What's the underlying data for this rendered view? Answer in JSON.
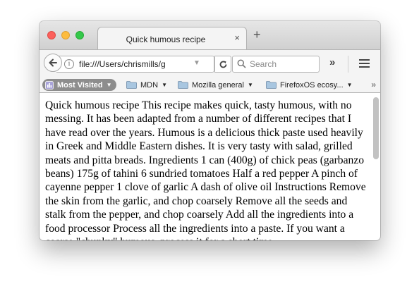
{
  "window": {
    "tab": {
      "title": "Quick humous recipe",
      "close_glyph": "×"
    },
    "new_tab_glyph": "+"
  },
  "navbar": {
    "url": "file:///Users/chrismills/g",
    "search_placeholder": "Search",
    "overflow_glyph": "»"
  },
  "bookmarks": {
    "items": [
      {
        "label": "Most Visited",
        "icon": "most-visited-icon",
        "dropdown": true
      },
      {
        "label": "MDN",
        "icon": "folder-icon",
        "dropdown": true
      },
      {
        "label": "Mozilla general",
        "icon": "folder-icon",
        "dropdown": true
      },
      {
        "label": "FirefoxOS ecosy...",
        "icon": "folder-icon",
        "dropdown": true
      }
    ],
    "overflow_glyph": "»"
  },
  "content": {
    "text": "Quick humous recipe This recipe makes quick, tasty humous, with no messing. It has been adapted from a number of different recipes that I have read over the years. Humous is a delicious thick paste used heavily in Greek and Middle Eastern dishes. It is very tasty with salad, grilled meats and pitta breads. Ingredients 1 can (400g) of chick peas (garbanzo beans) 175g of tahini 6 sundried tomatoes Half a red pepper A pinch of cayenne pepper 1 clove of garlic A dash of olive oil Instructions Remove the skin from the garlic, and chop coarsely Remove all the seeds and stalk from the pepper, and chop coarsely Add all the ingredients into a food processor Process all the ingredients into a paste. If you want a coarse \"chunky\" humous, process it for a short time."
  },
  "colors": {
    "close": "#fc605c",
    "minimize": "#fdbc40",
    "maximize": "#34c84a",
    "most_visited_bg": "#8d8d8d"
  }
}
